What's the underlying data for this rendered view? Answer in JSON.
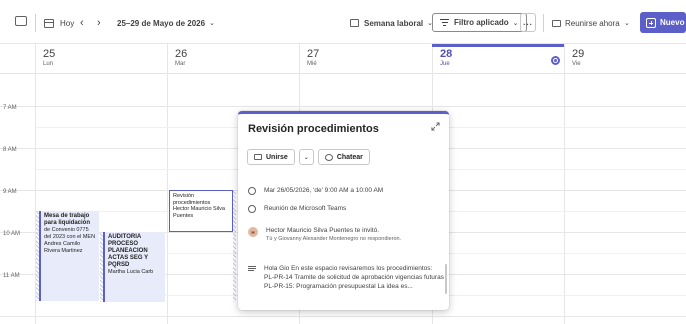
{
  "toolbar": {
    "today_label": "Hoy",
    "prev_icon": "chevron-left-icon",
    "next_icon": "chevron-right-icon",
    "range_label": "25–29 de Mayo de 2026",
    "view_label": "Semana laboral",
    "filter_label": "Filtro aplicado",
    "more_label": "...",
    "meet_label": "Reunirse ahora",
    "new_label": "Nuevo"
  },
  "days": [
    {
      "num": "25",
      "name": "Lun"
    },
    {
      "num": "26",
      "name": "Mar"
    },
    {
      "num": "27",
      "name": "Mié"
    },
    {
      "num": "28",
      "name": "Jue"
    },
    {
      "num": "29",
      "name": "Vie"
    }
  ],
  "hours": [
    "7 AM",
    "8 AM",
    "9 AM",
    "10 AM",
    "11 AM"
  ],
  "events": {
    "mesa": {
      "title": "Mesa de trabajo para liquidación",
      "body": "de Convenio 0775 del 2023 con el MEN",
      "person": "Andres Camilo Rivera Martinez"
    },
    "auditoria": {
      "title": "AUDITORIA PROCESO PLANEACION ACTAS SEG Y PQRSD",
      "person": "Martha Lucia Carb"
    },
    "revision": {
      "title": "Revisión procedimientos",
      "person": "Hector Mauricio Silva Puentes"
    }
  },
  "popup": {
    "title": "Revisión procedimientos",
    "join_label": "Unirse",
    "chat_label": "Chatear",
    "datetime": "Mar 26/05/2026, 'de' 9:00 AM a 10:00 AM",
    "location": "Reunión de Microsoft Teams",
    "avatar_initial": "H",
    "organizer": "Hector Mauricio Silva Puentes te invitó.",
    "responses": "Tú y Giovanny Alexander Montenegro no respondieron.",
    "description": "Hola Gio En este espacio revisaremos los procedimientos: PL-PR-14 Tramite de solicitud de aprobación vigencias futuras PL-PR-15: Programación presupuestal La idea es..."
  },
  "colors": {
    "accent": "#5b5fc7",
    "event_bg": "#e8ebfa"
  }
}
